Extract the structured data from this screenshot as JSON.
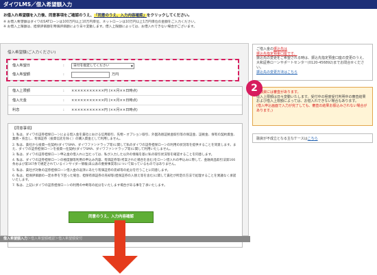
{
  "header": {
    "title": "ダイワLMS／借入希望額入力"
  },
  "intro": {
    "text": "お借入れ希望額を入力後、同意事項をご確認のうえ、",
    "highlight": "「同意のうえ、入力内容確認」",
    "text_end": "をクリックしてください。"
  },
  "notes": [
    "※ お借入希望額はダイワのSATローンは100万円以上10万円単位、ネットローンは10万円以上1万円単位の金額をご入力ください。",
    "※ お借入上限額は、担保評価額を時価評価額により日々変動します。借入上限額によっては、お借入れできない場合がございます。"
  ],
  "form": {
    "title": "借入希望額(ご入力ください)",
    "date_label": "借入希望日",
    "date_select": "日付を指定してください",
    "amount_label": "借入希望額",
    "amount_unit": "万円",
    "colon": ":"
  },
  "info_rows": [
    {
      "label": "借入上限額",
      "value": "×××××××××××円 (××月××日時点)"
    },
    {
      "label": "借入元金",
      "value": "×××××××××××円 (××月××日時点)"
    },
    {
      "label": "利息",
      "value": "×××××××××××円 (××月××日時点)"
    }
  ],
  "terms": {
    "title": "【同意事項】",
    "items": [
      "1. 私は、ダイワの証券担保ローンによる借入金を貴社における信用取引、先物・オプション取引、外国為替証拠金取引等の保証金、証拠金、保有の契約資金、業務・売出し、有価証券（投資信託を除く）の購入資金として利用しません。",
      "2. 私は、貴社から投資一任契約(ダイワSMA、ダイワファンドラップ等)に関して私のダイワの証券担保ローンの利用の状況等を提供することを同意します。また、ダイワの証券担保ローンを投資一任契約(ダイワSMA、ダイワファンドラップ等)に関して利用いたしません。",
      "3. 私は、ダイワの証券担保ローン申込金の借入れに当たっては、私が入力した以外の情報を基に私の取引状況等を確認することを同意します。",
      "4. 私は、ダイワの証券担保ローンの極度額等利用の申込み内容、有価証券等(考案された場合を含む)をローン借入れの申込みに際して、金融商品取引法第166条および第167条で規定されているインサイダー情報(未公表の重要事実等)について知っているものではありません。",
      "5. 私は、貴社が対象の証券担保ローン借入金の返済にあたり有価証券の売却等の処分を行うことに同意します。",
      "6. 私は、担保評価額の一定水準を下回った場合、担保有価証券の売却等(担保証券の入替え等を含む)に関して貴社が所定の方法で処理することを異議なく承諾いたします。",
      "7. 私は、上記にダイワの証券担保ローンの利用の中断等の処分をいたします場合がある事を了承いたします。"
    ]
  },
  "agree_button": "同意のうえ、入力内容確認",
  "breadcrumb": {
    "current": "借入希望額入力",
    "sep": "＞",
    "step2": "借入希望額確認",
    "step3": "借入希望額受付"
  },
  "right_panel": {
    "box1": {
      "text1": "ご借入金の",
      "red1": "振込先は",
      "red2": "振込先指定預金口座です。",
      "text2": "振込先の変更をご希望される時は、振込先指定預金口座の変更のうえ、大和証券ローンサポートセンター(0120-456892)までお問合せください。",
      "link": "振込先の変更方法はこちら"
    },
    "box2": {
      "red1": "ご融資には審査があります。",
      "text": "借入上限額は日々変動いたします。受付中の極度受付判明中の審査結果および借入上限額によっては、お借入れできない場合もあります。",
      "red2": "(借入申込画面で入力が完了しても、審査の結果お振込みされない場合があります。)"
    },
    "box3": {
      "text": "融資が不成立となる主なケースは",
      "link": "こちら"
    }
  },
  "badge": "2",
  "colors": {
    "header_bg": "#1d2f78",
    "dash_border": "#d71c5e",
    "badge_bg": "#d71c5e",
    "button_bg": "#5fae35",
    "arrow": "#e53b1c",
    "notice_bg": "#fff4d6"
  }
}
